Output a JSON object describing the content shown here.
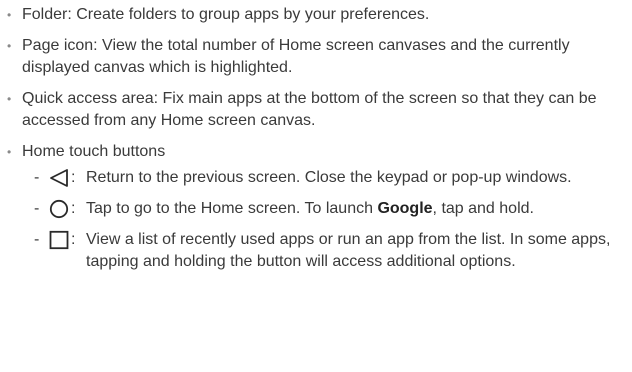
{
  "bullets": [
    {
      "text": "Folder: Create folders to group apps by your preferences."
    },
    {
      "text": "Page icon: View the total number of Home screen canvases and the currently displayed canvas which is highlighted."
    },
    {
      "text": "Quick access area: Fix main apps at the bottom of the screen so that they can be accessed from any Home screen canvas."
    },
    {
      "text": "Home touch buttons"
    }
  ],
  "home_buttons": [
    {
      "icon": "back-triangle-icon",
      "text": "Return to the previous screen. Close the keypad or pop-up windows."
    },
    {
      "icon": "home-circle-icon",
      "text_before": "Tap to go to the Home screen. To launch ",
      "bold": "Google",
      "text_after": ", tap and hold."
    },
    {
      "icon": "recent-square-icon",
      "text": "View a list of recently used apps or run an app from the list. In some apps, tapping and holding the button will access additional options."
    }
  ],
  "symbols": {
    "bullet": "•",
    "dash": "-",
    "colon": ":"
  }
}
